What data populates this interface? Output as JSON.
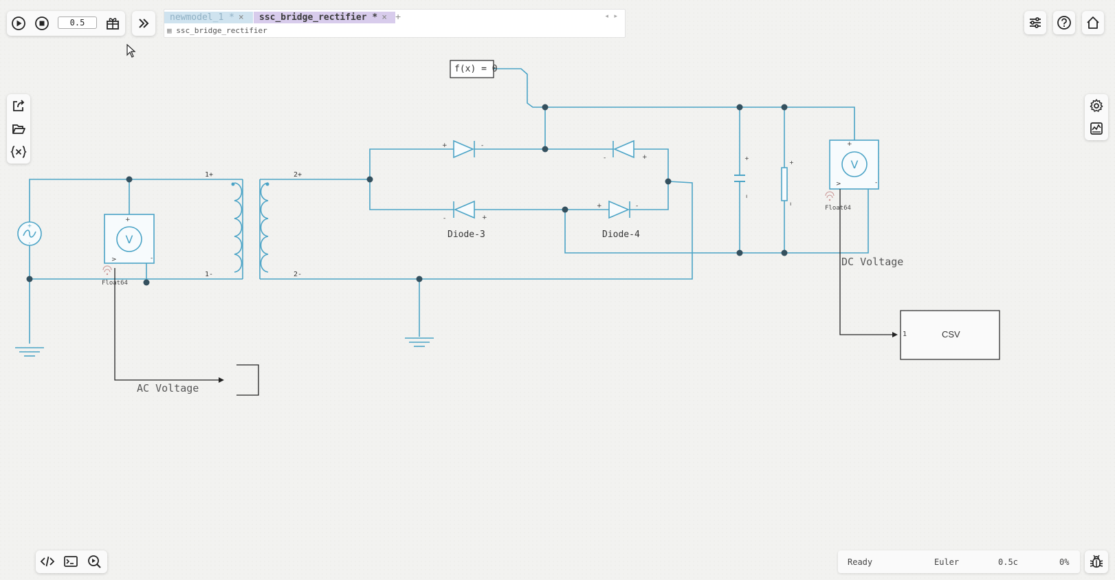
{
  "toolbar": {
    "time_value": "0.5"
  },
  "tabs": [
    {
      "label": "newmodel_1 *",
      "close": "×"
    },
    {
      "label": "ssc_bridge_rectifier *",
      "close": "×"
    }
  ],
  "tab_add": "+",
  "tab_scroll": "◂ ▸",
  "breadcrumb": "ssc_bridge_rectifier",
  "diagram": {
    "function_block": "f(x) = 0",
    "diode3_label": "Diode-3",
    "diode4_label": "Diode-4",
    "dc_voltage_label": "DC Voltage",
    "ac_voltage_label": "AC Voltage",
    "csv_label": "CSV",
    "csv_port": "1",
    "float_left": "Float64",
    "float_right": "Float64",
    "transformer_p_plus": "1+",
    "transformer_p_minus": "1-",
    "transformer_s_plus": "2+",
    "transformer_s_minus": "2-",
    "voltmeter_symbol": "V",
    "wire_color": "#4aa3c6",
    "node_color": "#34505e"
  },
  "status": {
    "state": "Ready",
    "solver": "Euler",
    "time": "0.5c",
    "progress": "0%"
  }
}
